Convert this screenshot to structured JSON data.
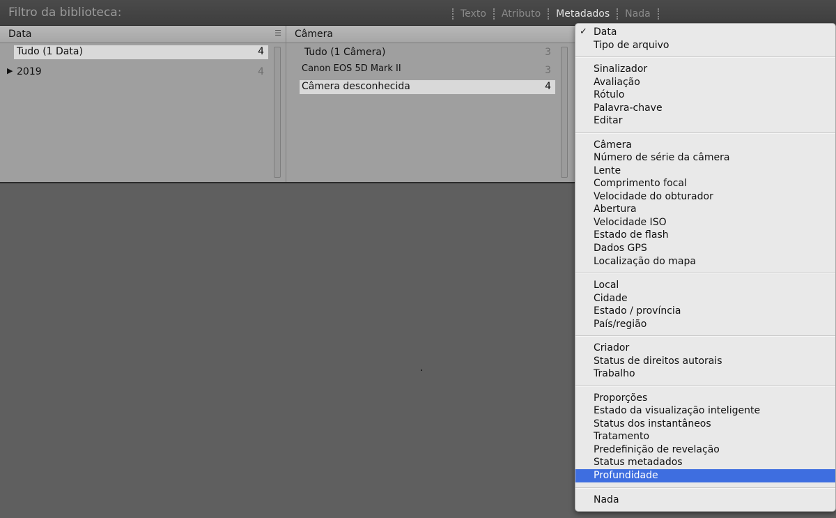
{
  "filter_bar": {
    "title": "Filtro da biblioteca:",
    "tabs": [
      "Texto",
      "Atributo",
      "Metadados",
      "Nada"
    ],
    "active_tab": "Metadados"
  },
  "columns": {
    "data": {
      "header": "Data",
      "rows": [
        {
          "label": "Tudo (1 Data)",
          "count": "4"
        },
        {
          "label": "2019",
          "count": "4"
        }
      ]
    },
    "camera": {
      "header": "Câmera",
      "rows": [
        {
          "label": "Tudo (1 Câmera)",
          "count": "3"
        },
        {
          "label": "Canon EOS 5D Mark II",
          "count": "3"
        },
        {
          "label": "Câmera desconhecida",
          "count": "4"
        }
      ]
    }
  },
  "menu": {
    "checked": "Data",
    "groups": [
      [
        "Data",
        "Tipo de arquivo"
      ],
      [
        "Sinalizador",
        "Avaliação",
        "Rótulo",
        "Palavra-chave",
        "Editar"
      ],
      [
        "Câmera",
        "Número de série da câmera",
        "Lente",
        "Comprimento focal",
        "Velocidade do obturador",
        "Abertura",
        "Velocidade ISO",
        "Estado de flash",
        "Dados GPS",
        "Localização do mapa"
      ],
      [
        "Local",
        "Cidade",
        "Estado / província",
        "País/região"
      ],
      [
        "Criador",
        "Status de direitos autorais",
        "Trabalho"
      ],
      [
        "Proporções",
        "Estado da visualização inteligente",
        "Status dos instantâneos",
        "Tratamento",
        "Predefinição de revelação",
        "Status metadados",
        "Profundidade"
      ],
      [
        "Nada"
      ]
    ],
    "highlighted": "Profundidade"
  },
  "colors": {
    "highlight": "#3e6ee0",
    "background": "#5f5f5f"
  }
}
